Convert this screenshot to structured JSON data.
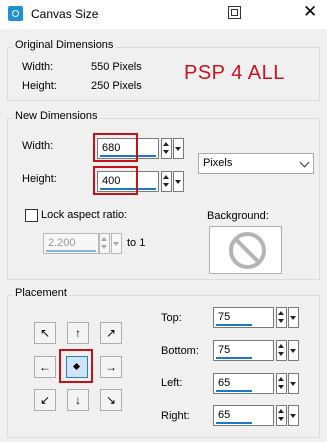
{
  "window": {
    "title": "Canvas Size",
    "close_glyph": "✕"
  },
  "watermark": "PSP 4 ALL",
  "original": {
    "group_title": "Original Dimensions",
    "width_label": "Width:",
    "width_value": "550 Pixels",
    "height_label": "Height:",
    "height_value": "250 Pixels"
  },
  "new_dims": {
    "group_title": "New Dimensions",
    "width_label": "Width:",
    "width_value": "680",
    "height_label": "Height:",
    "height_value": "400",
    "units": "Pixels",
    "lock_label": "Lock aspect ratio:",
    "lock_checked": false,
    "ratio_value": "2.200",
    "ratio_suffix": "to 1",
    "background_label": "Background:"
  },
  "placement": {
    "group_title": "Placement",
    "top_label": "Top:",
    "top_value": "75",
    "bottom_label": "Bottom:",
    "bottom_value": "75",
    "left_label": "Left:",
    "left_value": "65",
    "right_label": "Right:",
    "right_value": "65",
    "selected": "center",
    "arrows": {
      "tl": "↖",
      "t": "↑",
      "tr": "↗",
      "l": "←",
      "r": "→",
      "bl": "↙",
      "b": "↓",
      "br": "↘"
    }
  },
  "colors": {
    "highlight_red": "#c0141a",
    "watermark_red": "#c8141e",
    "accent_blue": "#1e78c8"
  }
}
